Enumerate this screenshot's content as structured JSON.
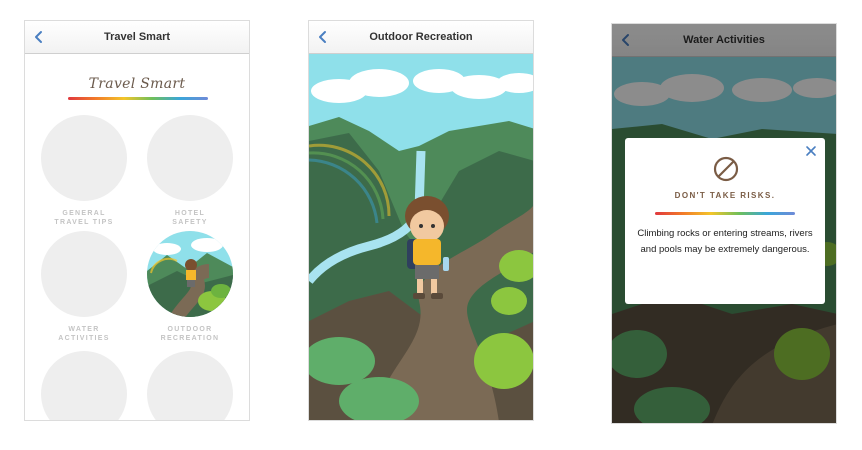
{
  "screens": [
    {
      "nav_title": "Travel Smart",
      "brand_title": "Travel Smart",
      "tiles": [
        {
          "line1": "GENERAL",
          "line2": "TRAVEL TIPS"
        },
        {
          "line1": "HOTEL",
          "line2": "SAFETY"
        },
        {
          "line1": "WATER",
          "line2": "ACTIVITIES"
        },
        {
          "line1": "OUTDOOR",
          "line2": "RECREATION"
        },
        {
          "line1": "",
          "line2": ""
        },
        {
          "line1": "",
          "line2": ""
        }
      ]
    },
    {
      "nav_title": "Outdoor Recreation"
    },
    {
      "nav_title": "Water Activities",
      "modal": {
        "heading": "DON'T TAKE RISKS.",
        "body": "Climbing rocks or entering streams, rivers and pools may be extremely dangerous."
      }
    }
  ],
  "icons": {
    "back": "chevron-left-icon",
    "close": "close-icon",
    "ban": "prohibited-icon"
  },
  "colors": {
    "accent_blue": "#4a7fc1",
    "brand_brown": "#7a5c45",
    "sky": "#8fe0ea",
    "mountain_green": "#4e8a5a",
    "path_brown": "#7b6a55"
  }
}
